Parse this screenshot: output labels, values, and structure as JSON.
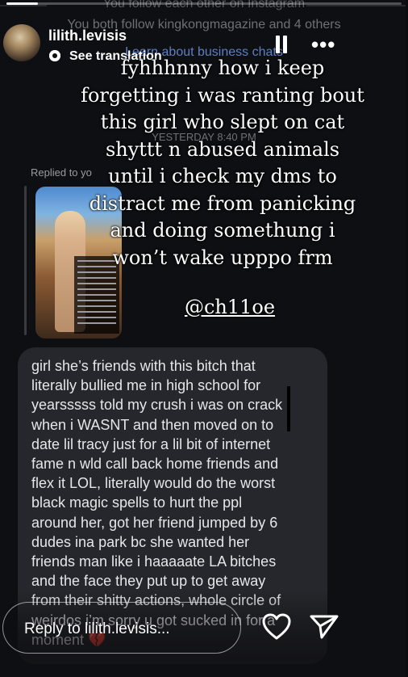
{
  "background_dm": {
    "follow_line": "You follow each other on Instagram",
    "both_follow_line": "You both follow kingkongmagazine and 4 others",
    "business_link": "Learn about business chats",
    "date_line": "YESTERDAY 8:40 PM"
  },
  "story": {
    "progress": 0.08,
    "username": "lilith.levisis",
    "translate_label": "See translation",
    "caption_lines": [
      "fyhhhnny how i keep",
      "forgetting i was ranting bout",
      "this girl who slept on cat",
      "shyttt n abused animals",
      "until i check my dms to",
      "distract me from panicking",
      "and doing somethung i",
      "won’t wake upppo frm"
    ],
    "mention": "@ch11oe"
  },
  "dm": {
    "replied_label": "Replied to yo",
    "message_text": "girl she’s friends with this bitch that\nliterally bullied me in high school for\nyearsssss told my crush i was on crack\nwhen i WASNT and then moved on to\ndate lil tracy just for a lil bit of internet\nfame n wld call back home friends and\nflex it LOL, literally would do the worst\nblack magic spells to hurt the ppl\naround her, got her friend jumped by 6\ndudes ina park bc she wanted her\nfriends man like i haaaaate LA bitches\nand the face they put up to get away\nfrom their shitty actions, whole circle of\nweirdos i’m sorry u got sucked in for a\nmoment 💔"
  },
  "reply": {
    "placeholder": "Reply to lilith.levisis..."
  },
  "icons": {
    "pause": "pause-icon",
    "more": "more-icon",
    "heart": "heart-icon",
    "send": "send-icon",
    "translate": "translate-icon"
  }
}
